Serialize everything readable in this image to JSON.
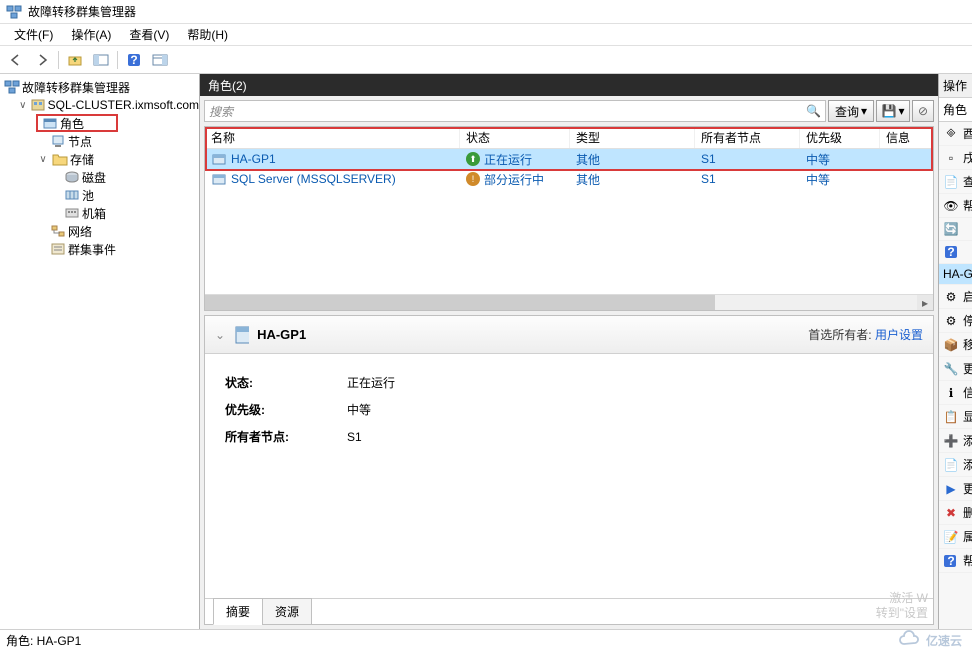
{
  "window": {
    "title": "故障转移群集管理器"
  },
  "menu": {
    "file": "文件(F)",
    "action": "操作(A)",
    "view": "查看(V)",
    "help": "帮助(H)"
  },
  "tree": {
    "root": "故障转移群集管理器",
    "cluster": "SQL-CLUSTER.ixmsoft.com",
    "roles": "角色",
    "nodes": "节点",
    "storage": "存储",
    "disks": "磁盘",
    "pools": "池",
    "enclosures": "机箱",
    "networks": "网络",
    "events": "群集事件"
  },
  "center": {
    "header": "角色(2)",
    "search_placeholder": "搜索",
    "query_btn": "查询",
    "cols": {
      "name": "名称",
      "status": "状态",
      "type": "类型",
      "owner": "所有者节点",
      "priority": "优先级",
      "info": "信息"
    },
    "rows": [
      {
        "name": "HA-GP1",
        "status": "正在运行",
        "type": "其他",
        "owner": "S1",
        "priority": "中等",
        "dot": "green",
        "selected": true
      },
      {
        "name": "SQL Server (MSSQLSERVER)",
        "status": "部分运行中",
        "type": "其他",
        "owner": "S1",
        "priority": "中等",
        "dot": "orange",
        "selected": false
      }
    ]
  },
  "detail": {
    "title": "HA-GP1",
    "pref_owner_label": "首选所有者:",
    "pref_owner_link": "用户设置",
    "status_label": "状态:",
    "status_value": "正在运行",
    "priority_label": "优先级:",
    "priority_value": "中等",
    "owner_label": "所有者节点:",
    "owner_value": "S1",
    "tab_summary": "摘要",
    "tab_resource": "资源"
  },
  "actions": {
    "title": "操作",
    "section1": "角色",
    "items1": [
      "酉",
      "戌",
      "查",
      "帮"
    ],
    "section2": "HA-G",
    "items2": [
      "启",
      "停",
      "移",
      "更",
      "信",
      "显",
      "添",
      "添",
      "更",
      "删",
      "属",
      "帮"
    ]
  },
  "statusbar": "角色: HA-GP1",
  "watermark": {
    "l1": "激活 W",
    "l2": "转到\"设置"
  },
  "brand": "亿速云"
}
